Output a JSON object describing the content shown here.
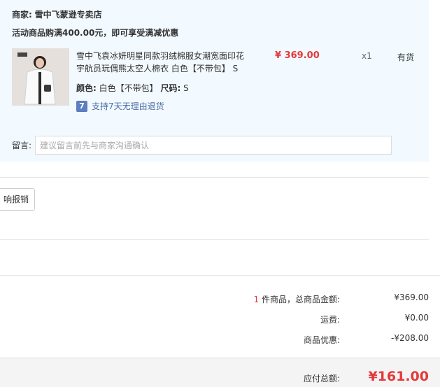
{
  "shop": {
    "label": "商家:",
    "name": "雪中飞蒙逊专卖店"
  },
  "promo": "活动商品购满400.00元，即可享受满减优惠",
  "product": {
    "title_line1": "雪中飞袁冰妍明星同款羽绒棉服女潮宽面印花",
    "title_line2": "宇航员玩偶熊太空人棉衣 白色【不带包】 S",
    "price": "¥ 369.00",
    "qty": "x1",
    "stock": "有货",
    "color_label": "颜色:",
    "color_value": "白色【不带包】",
    "size_label": "尺码:",
    "size_value": "S",
    "return_badge": "7",
    "return_policy": "支持7天无理由退货"
  },
  "remark": {
    "label": "留言:",
    "placeholder": "建议留言前先与商家沟通确认"
  },
  "invoice_button": "响报销",
  "summary": {
    "count": "1",
    "items_label": " 件商品，总商品金额:",
    "items_value": "¥369.00",
    "shipping_label": "运费:",
    "shipping_value": "¥0.00",
    "discount_label": "商品优惠:",
    "discount_value": "-¥208.00"
  },
  "footer": {
    "total_label": "应付总额:",
    "total_value": "¥161.00"
  },
  "colors": {
    "accent": "#e4393c",
    "panel": "#f2f9ff",
    "badge": "#5b7fbf"
  }
}
